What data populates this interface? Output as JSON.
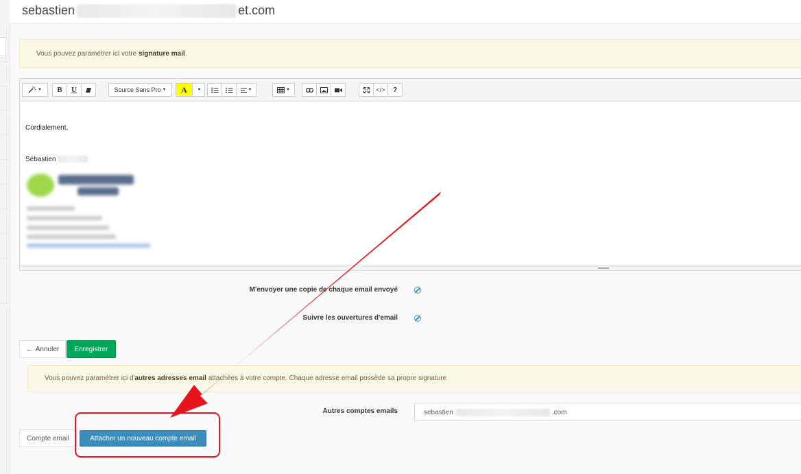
{
  "header": {
    "title_prefix": "sebastien",
    "title_suffix": "et.com"
  },
  "signature_notice": {
    "text_before": "Vous pouvez paramétrer ici votre ",
    "text_bold": "signature mail",
    "text_after": "."
  },
  "editor": {
    "toolbar": {
      "magic_icon": "magic-wand-icon",
      "bold": "B",
      "underline": "U",
      "eraser_icon": "eraser-icon",
      "font_family": "Source Sans Pro",
      "color_letter": "A",
      "ul_icon": "unordered-list-icon",
      "ol_icon": "ordered-list-icon",
      "align_icon": "align-icon",
      "table_icon": "table-icon",
      "link_icon": "link-icon",
      "picture_icon": "picture-icon",
      "video_icon": "video-icon",
      "fullscreen_icon": "fullscreen-icon",
      "code": "</>",
      "help": "?"
    },
    "body": {
      "line1": "Cordialement,",
      "line2": "Sébastien"
    }
  },
  "options": {
    "copy_label": "M'envoyer une copie de chaque email envoyé",
    "track_label": "Suivre les ouvertures d'email"
  },
  "actions": {
    "cancel": "Annuler",
    "save": "Enregistrer"
  },
  "accounts_notice": {
    "text_before": "Vous pouvez paramétrer ici d'",
    "text_bold": "autres adresses email",
    "text_after": " attachées à votre compte. Chaque adresse email possède sa propre signature"
  },
  "accounts": {
    "label": "Autres comptes emails",
    "value_prefix": "sebastien",
    "value_suffix": ".com",
    "compte_button": "Compte email",
    "attach_button": "Attacher un nouveau compte email"
  },
  "colors": {
    "success": "#00a65a",
    "primary": "#3c8dbc",
    "annotation": "#e8141c",
    "notice_bg": "#fcf8e8"
  }
}
